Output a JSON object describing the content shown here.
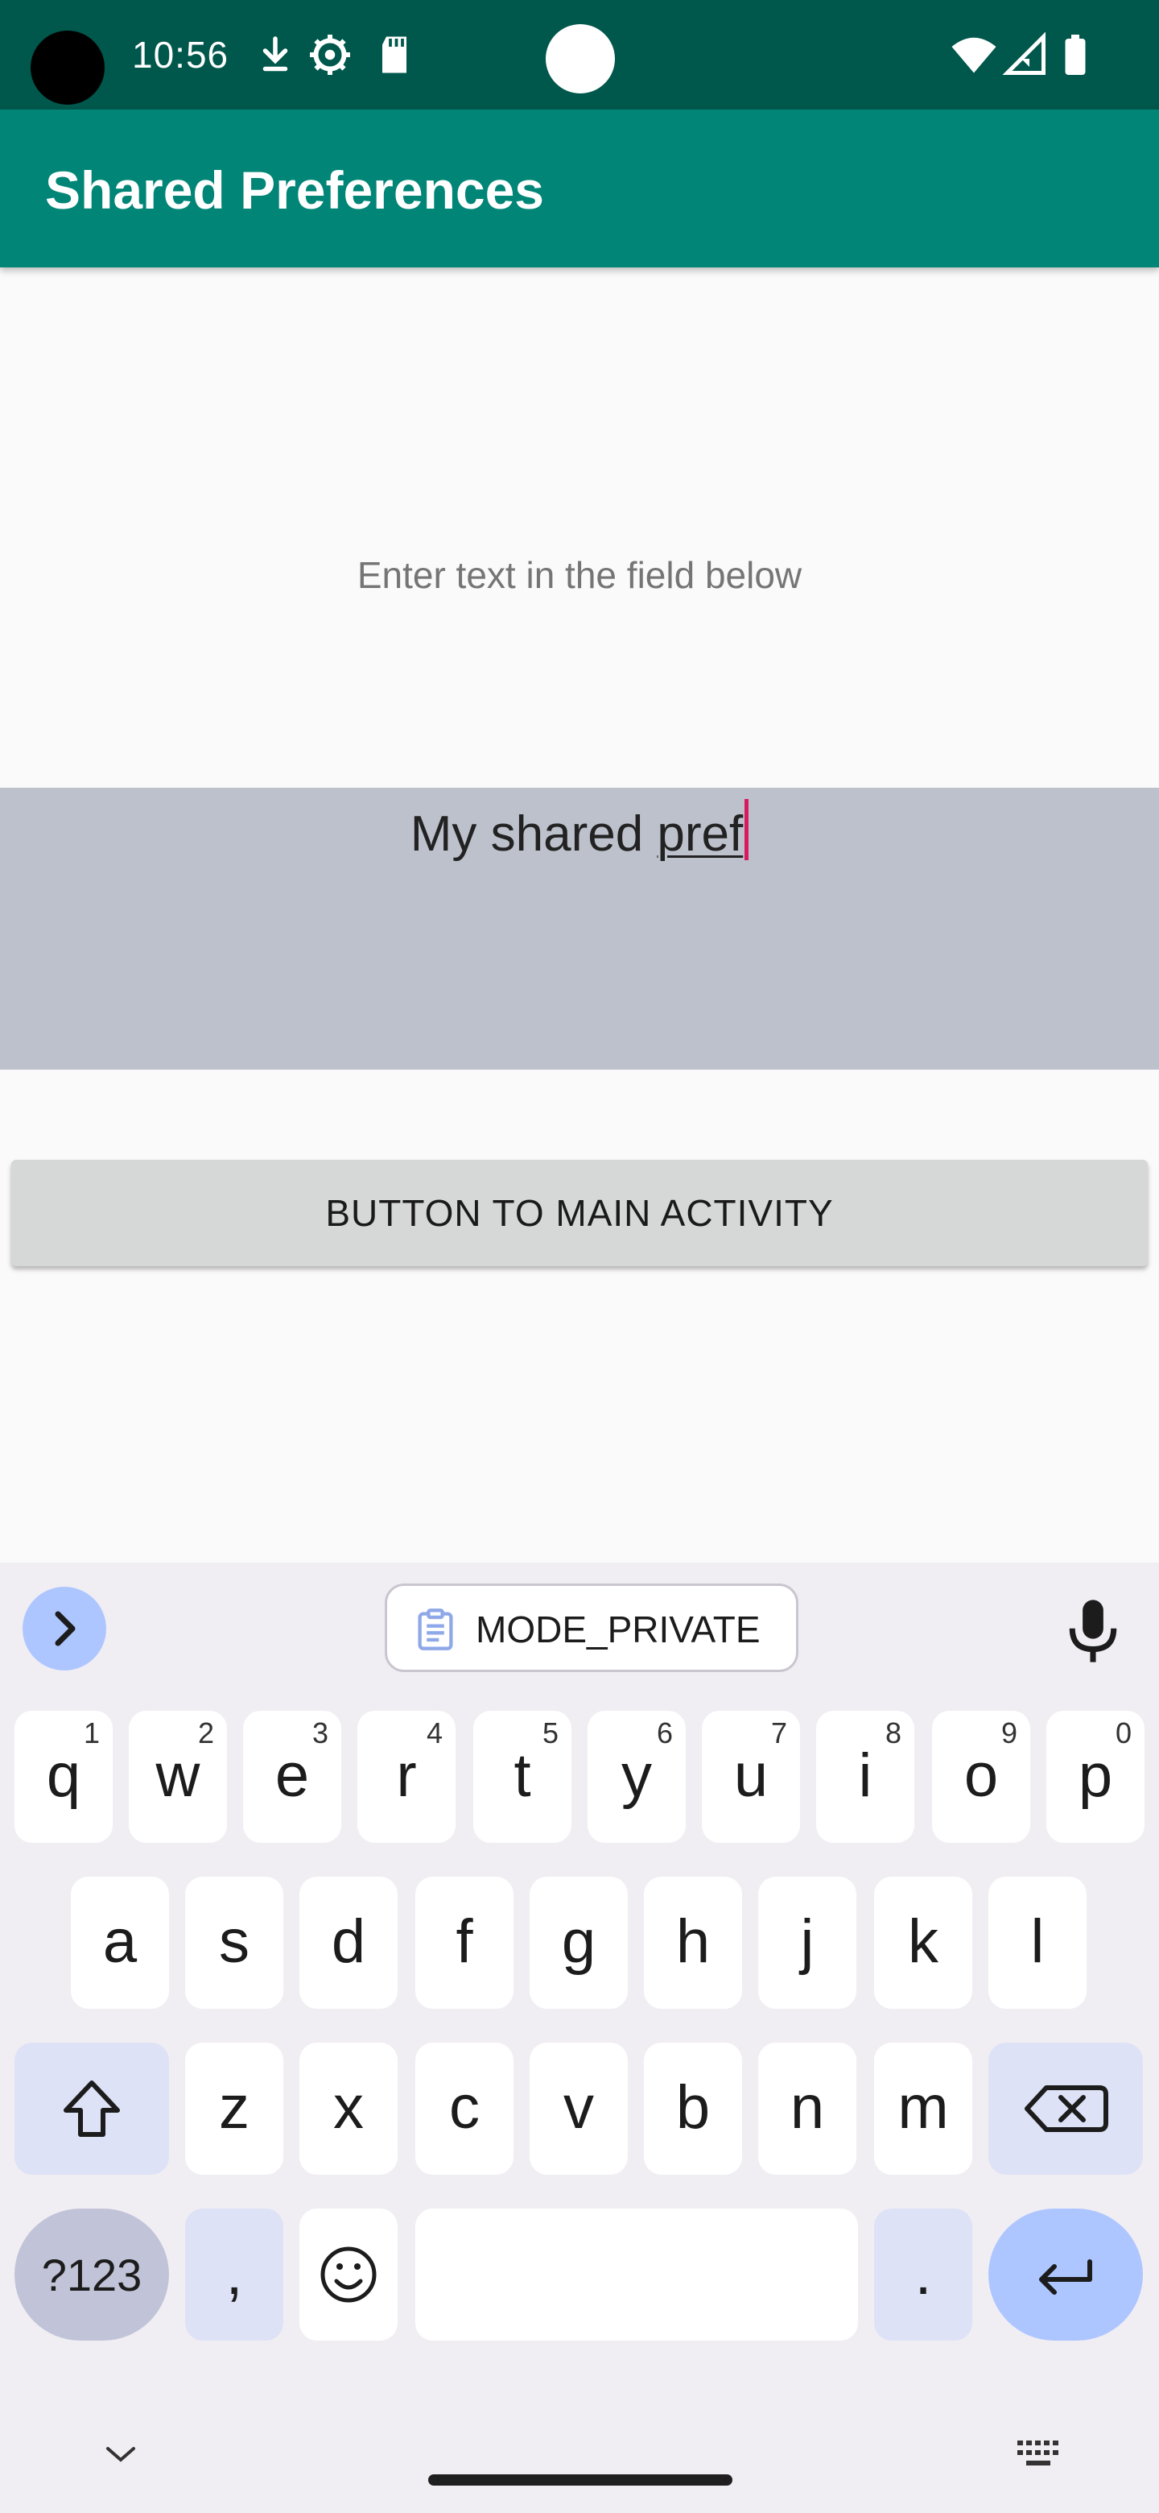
{
  "status_bar": {
    "time": "10:56"
  },
  "app_bar": {
    "title": "Shared Preferences"
  },
  "content": {
    "hint": "Enter text in the field below",
    "edit_text": {
      "committed": "My shared ",
      "composing": "pref"
    },
    "button_label": "BUTTON TO MAIN ACTIVITY"
  },
  "keyboard": {
    "suggestion": "MODE_PRIVATE",
    "row1": [
      {
        "char": "q",
        "hint": "1"
      },
      {
        "char": "w",
        "hint": "2"
      },
      {
        "char": "e",
        "hint": "3"
      },
      {
        "char": "r",
        "hint": "4"
      },
      {
        "char": "t",
        "hint": "5"
      },
      {
        "char": "y",
        "hint": "6"
      },
      {
        "char": "u",
        "hint": "7"
      },
      {
        "char": "i",
        "hint": "8"
      },
      {
        "char": "o",
        "hint": "9"
      },
      {
        "char": "p",
        "hint": "0"
      }
    ],
    "row2": [
      "a",
      "s",
      "d",
      "f",
      "g",
      "h",
      "j",
      "k",
      "l"
    ],
    "row3": [
      "z",
      "x",
      "c",
      "v",
      "b",
      "n",
      "m"
    ],
    "symbols_label": "?123",
    "comma": ",",
    "period": "."
  },
  "colors": {
    "status_bar": "#00574b",
    "app_bar": "#008577",
    "cursor": "#d81b60",
    "edit_background": "#bdc1cc",
    "keyboard_accent": "#aec6ff"
  }
}
